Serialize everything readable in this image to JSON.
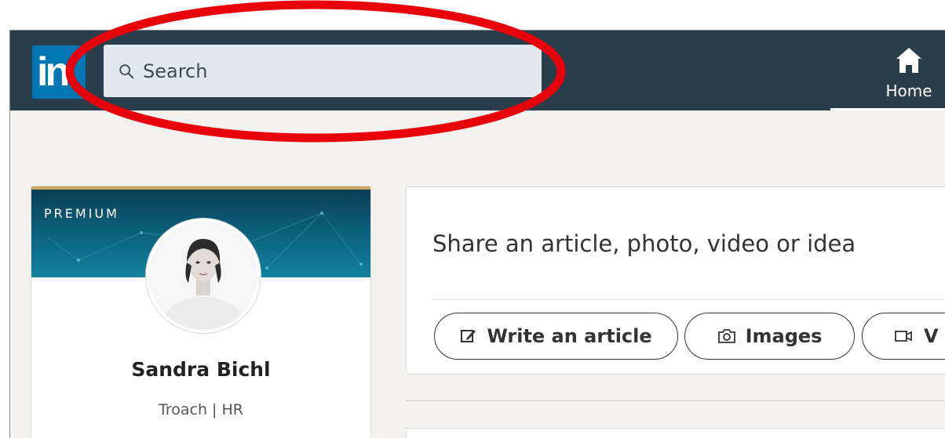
{
  "topbar": {
    "logo_text": "in",
    "search_placeholder": "Search",
    "nav": [
      {
        "label": "Home",
        "icon": "home-icon"
      }
    ]
  },
  "profile": {
    "premium_label": "PREMIUM",
    "name": "Sandra Bichl",
    "headline": "Troach | HR"
  },
  "share_box": {
    "prompt": "Share an article, photo, video or idea",
    "actions": [
      {
        "label": "Write an article",
        "icon": "edit-icon"
      },
      {
        "label": "Images",
        "icon": "camera-icon"
      },
      {
        "label": "V",
        "icon": "video-icon"
      }
    ]
  },
  "colors": {
    "topbar": "#293e4a",
    "search_bg": "#e1e9ee",
    "annotation": "#e8000b",
    "premium_gold": "#c9a85d"
  }
}
